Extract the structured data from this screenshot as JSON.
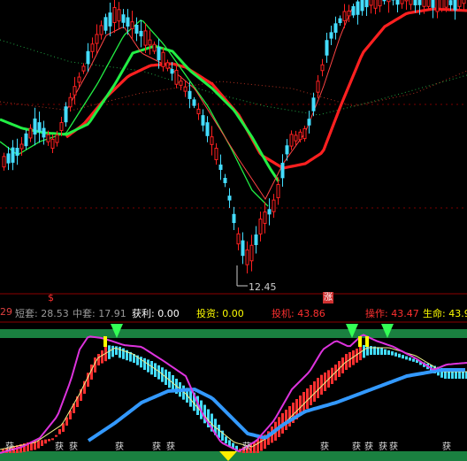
{
  "chart_data": [
    {
      "type": "candlestick",
      "panel": "price",
      "annotations": {
        "low_marker": "12.45"
      },
      "legend": [],
      "series": [
        {
          "kind": "moving-average",
          "color": "#ff2020",
          "style": "thick"
        },
        {
          "kind": "moving-average",
          "color": "#22ee44",
          "style": "thick"
        },
        {
          "kind": "moving-average",
          "color": "#22ee44",
          "style": "thin"
        },
        {
          "kind": "moving-average",
          "color": "#ff4444",
          "style": "thin"
        },
        {
          "kind": "moving-average",
          "color": "#20a040",
          "style": "dotted"
        },
        {
          "kind": "moving-average",
          "color": "#b03020",
          "style": "dotted"
        }
      ]
    },
    {
      "type": "indicator",
      "panel": "sub",
      "header": [
        {
          "label": "29",
          "color": "#e04040"
        },
        {
          "label": "短套: 28.53",
          "color": "#9a9a9a"
        },
        {
          "label": "中套: 17.91",
          "color": "#9a9a9a"
        },
        {
          "label": "获利: 0.00",
          "color": "#ffffff"
        },
        {
          "label": "投资: 0.00",
          "color": "#ffff00"
        },
        {
          "label": "投机: 43.86",
          "color": "#ff3030"
        },
        {
          "label": "操作: 43.47",
          "color": "#ff3030"
        },
        {
          "label": "生命: 43.9",
          "color": "#ffff00"
        }
      ],
      "markers": {
        "buy_char": "获",
        "up_char": "涨",
        "dollar": "$"
      }
    }
  ],
  "colors": {
    "background": "#000000",
    "up": "#ff2020",
    "down": "#44ddff",
    "grid": "#8b0000"
  }
}
